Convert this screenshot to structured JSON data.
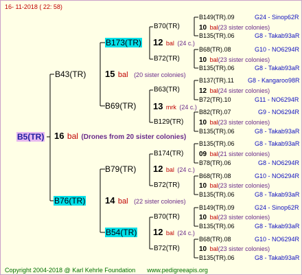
{
  "header": {
    "date": "16- 11-2018 ( 22: 58)"
  },
  "footer": {
    "copyright": "Copyright 2004-2018 @ Karl Kehrle Foundation",
    "url": "www.pedigreeapis.org"
  },
  "root": {
    "id": "B5(TR)",
    "num": "16",
    "bal": "bal",
    "note": "(Drones from 20 sister colonies)"
  },
  "gen1": [
    {
      "id": "B43(TR)",
      "num": "15",
      "bal": "bal",
      "note": "(20 sister colonies)"
    },
    {
      "id": "B76(TR)",
      "num": "14",
      "bal": "bal",
      "note": "(22 sister colonies)"
    }
  ],
  "gen2": [
    {
      "id": "B173(TR)",
      "num": "12",
      "bal": "bal",
      "note": "(24 c.)"
    },
    {
      "id": "B69(TR)",
      "num": "13",
      "bal": "mrk",
      "note": "(24 c.)"
    },
    {
      "id": "B79(TR)",
      "num": "12",
      "bal": "bal",
      "note": "(24 c.)"
    },
    {
      "id": "B54(TR)",
      "num": "12",
      "bal": "bal",
      "note": "(24 c.)"
    }
  ],
  "gen3": [
    {
      "id": "B70(TR)",
      "num": "12",
      "bal": "bal",
      "note": "(24 c.)"
    },
    {
      "id": "B72(TR)",
      "num": "",
      "bal": "",
      "note": ""
    },
    {
      "id": "B63(TR)",
      "num": "13",
      "bal": "mrk",
      "note": "(24 c.)"
    },
    {
      "id": "B129(TR)",
      "num": "",
      "bal": "",
      "note": ""
    },
    {
      "id": "B174(TR)",
      "num": "12",
      "bal": "bal",
      "note": "(24 c.)"
    },
    {
      "id": "B72(TR)",
      "num": "",
      "bal": "",
      "note": ""
    },
    {
      "id": "B70(TR)",
      "num": "12",
      "bal": "bal",
      "note": "(24 c.)"
    },
    {
      "id": "B72(TR)",
      "num": "",
      "bal": "",
      "note": ""
    }
  ],
  "gen4": [
    {
      "left": "B149(TR).09",
      "right": "G24 - Sinop62R"
    },
    {
      "num": "10",
      "bal": "bal",
      "note": "(23 sister colonies)"
    },
    {
      "left": "B135(TR).06",
      "right": "G8 - Takab93aR"
    },
    {
      "left": "B68(TR).08",
      "right": "G10 - NO6294R"
    },
    {
      "num": "10",
      "bal": "bal",
      "note": "(23 sister colonies)"
    },
    {
      "left": "B135(TR).06",
      "right": "G8 - Takab93aR"
    },
    {
      "left": "B137(TR).11",
      "right": "G8 - Kangaroo98R"
    },
    {
      "num": "12",
      "bal": "bal",
      "note": "(24 sister colonies)"
    },
    {
      "left": "B72(TR).10",
      "right": "G11 - NO6294R"
    },
    {
      "left": "B82(TR).07",
      "right": "G9 - NO6294R"
    },
    {
      "num": "10",
      "bal": "bal",
      "note": "(23 sister colonies)"
    },
    {
      "left": "B135(TR).06",
      "right": "G8 - Takab93aR"
    },
    {
      "left": "B135(TR).06",
      "right": "G8 - Takab93aR"
    },
    {
      "num": "09",
      "bal": "bal",
      "note": "(21 sister colonies)"
    },
    {
      "left": "B78(TR).06",
      "right": "G8 - NO6294R"
    },
    {
      "left": "B68(TR).08",
      "right": "G10 - NO6294R"
    },
    {
      "num": "10",
      "bal": "bal",
      "note": "(23 sister colonies)"
    },
    {
      "left": "B135(TR).06",
      "right": "G8 - Takab93aR"
    },
    {
      "left": "B149(TR).09",
      "right": "G24 - Sinop62R"
    },
    {
      "num": "10",
      "bal": "bal",
      "note": "(23 sister colonies)"
    },
    {
      "left": "B135(TR).06",
      "right": "G8 - Takab93aR"
    },
    {
      "left": "B68(TR).08",
      "right": "G10 - NO6294R"
    },
    {
      "num": "10",
      "bal": "bal",
      "note": "(23 sister colonies)"
    },
    {
      "left": "B135(TR).06",
      "right": "G8 - Takab93aR"
    }
  ]
}
